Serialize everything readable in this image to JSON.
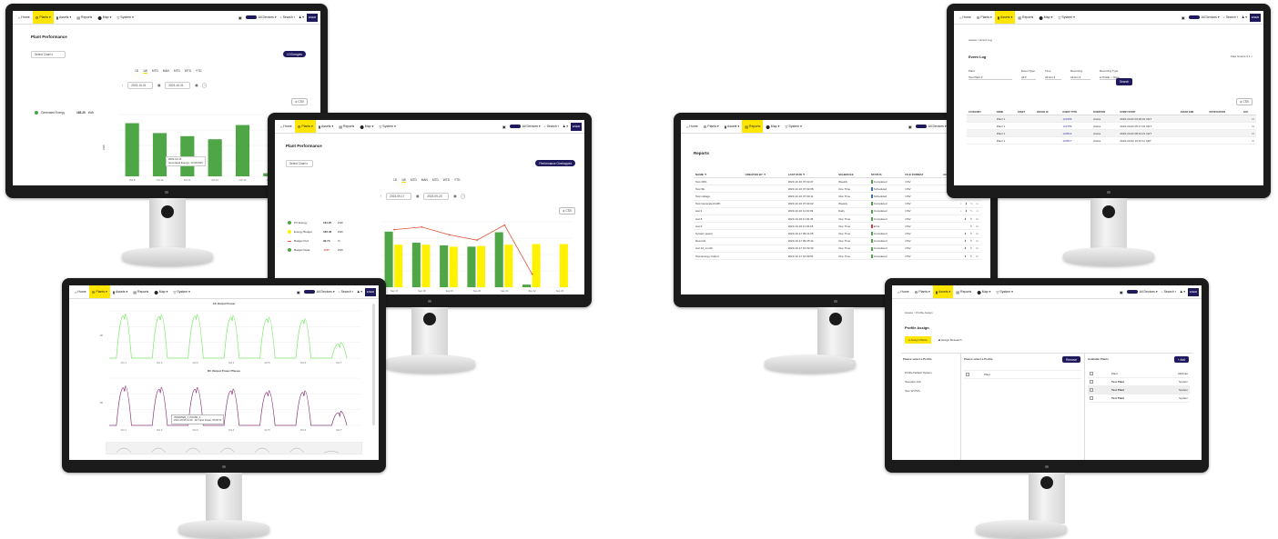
{
  "nav": {
    "items": [
      {
        "icon": "home-icon",
        "glyph": "⌂",
        "label": "Home"
      },
      {
        "icon": "plants-icon",
        "glyph": "⚙",
        "label": "Plants ▾"
      },
      {
        "icon": "assets-icon",
        "glyph": "▮",
        "label": "Assets ▾"
      },
      {
        "icon": "reports-icon",
        "glyph": "▤",
        "label": "Reports"
      },
      {
        "icon": "map-icon",
        "glyph": "⬤",
        "label": "Map ▾"
      },
      {
        "icon": "system-icon",
        "glyph": "▽",
        "label": "System ▾"
      }
    ],
    "right": {
      "bell": "▣",
      "all_devices": "All Devices ▾",
      "search": "⌕ Search ▾",
      "user": "♟ ▾",
      "logo": "ENER"
    }
  },
  "colors": {
    "accent_yellow": "#ffe600",
    "brand_navy": "#1f1a5e",
    "bar_green": "#4ea646",
    "bar_yellow": "#fff200",
    "line_red": "#e0553a",
    "line_green": "#7de86a",
    "line_purple": "#8a3a78"
  },
  "m1": {
    "title": "Plant Performance",
    "select": "Select Chart ▾",
    "badge": "10 Energies",
    "periods": [
      "1D",
      "1W",
      "MTD",
      "MAN",
      "MTD",
      "WTD",
      "YTD"
    ],
    "date_from": "2023-10-01",
    "date_to": "2023-10-31",
    "csv": "⬇ CSV",
    "legend_label": "Generated Energy",
    "legend_value": "165.20",
    "legend_unit": "kWh",
    "ylabel": "kWh",
    "tooltip_1": "2023-10-15",
    "tooltip_2": "Generated Energy: 13.00 kWh",
    "chart_data": {
      "type": "bar",
      "categories": [
        "Oct 9",
        "Oct 10",
        "Oct 11",
        "Oct 12",
        "Oct 13",
        "Oct 14"
      ],
      "values": [
        86,
        70,
        65,
        60,
        83,
        5
      ],
      "ylim": [
        0,
        100
      ]
    }
  },
  "m2": {
    "title": "Plant Performance",
    "select": "Select Chart ▾",
    "badge": "Performance Overlapped",
    "periods": [
      "1D",
      "1W",
      "MTD",
      "MAN",
      "MTD",
      "WTD",
      "YTD"
    ],
    "date_from": "2023-09-17",
    "date_to": "2023-09-23",
    "csv": "⬇ CSV",
    "legend": [
      {
        "color": "#4ea646",
        "label": "PV Energy",
        "value": "181.25",
        "unit": "kWh"
      },
      {
        "color": "#fff200",
        "label": "Energy Budget",
        "value": "182.48",
        "unit": "kWh"
      },
      {
        "color": "#e0553a",
        "label": "Budget Perf.",
        "value": "99.73",
        "unit": "%"
      },
      {
        "color": "#4ea646",
        "label": "Budget Delta",
        "value": "-0.07",
        "unit": "kWh"
      }
    ],
    "chart_data": {
      "type": "bar",
      "categories": [
        "Sep 17",
        "Sep 18",
        "Sep 19",
        "Sep 20",
        "Sep 21",
        "Sep 22",
        "Sep 23"
      ],
      "series": [
        {
          "name": "PV Energy",
          "values": [
            85,
            68,
            64,
            62,
            84,
            4,
            0
          ]
        },
        {
          "name": "Energy Budget",
          "values": [
            65,
            65,
            62,
            63,
            65,
            66,
            66
          ]
        },
        {
          "name": "Budget Perf.",
          "values": [
            88,
            92,
            80,
            72,
            95,
            20,
            0
          ]
        }
      ],
      "ylim": [
        0,
        100
      ]
    }
  },
  "m3": {
    "chart1_title": "AC Output Power",
    "chart2_title": "DC Output Power Phases",
    "tooltip_1": "INVERTER_1_PHASE_A",
    "tooltip_2": "2023-10-05 14:10 · DC Input Power: 86.50 W",
    "ylabel": "W",
    "chart_data": [
      {
        "type": "line",
        "title": "AC Output Power",
        "x": [
          "Oct 1",
          "Oct 2",
          "Oct 3",
          "Oct 4",
          "Oct 5",
          "Oct 6",
          "Oct 7"
        ],
        "y_peaks": [
          1400,
          1380,
          1390,
          1350,
          1300,
          1250,
          500
        ],
        "ylim": [
          0,
          1500
        ]
      },
      {
        "type": "line",
        "title": "DC Output Power Phases",
        "x": [
          "Oct 1",
          "Oct 2",
          "Oct 3",
          "Oct 4",
          "Oct 5",
          "Oct 6",
          "Oct 7"
        ],
        "y_peaks": [
          1250,
          1200,
          1200,
          1150,
          1100,
          1100,
          450
        ],
        "ylim": [
          0,
          1500
        ]
      }
    ]
  },
  "m4": {
    "title": "Reports",
    "create": "+ Create",
    "columns": [
      "NAME ▼",
      "CREATED BY ▼",
      "LAST RUN ▼",
      "SCHEDULE",
      "STATUS",
      "FILE FORMAT",
      "ACTIONS"
    ],
    "rows": [
      {
        "name": "Test 20%",
        "by": "",
        "last": "2023-10-16 07:01:07",
        "sched": "Weekly",
        "status": "Completed",
        "sc": "#4ea646",
        "fmt": "CSV",
        "act": "⌕ ⬇ ✎ ⊡"
      },
      {
        "name": "Test 5E",
        "by": "",
        "last": "2023-10-16 07:02:08",
        "sched": "One Time",
        "status": "Scheduled",
        "sc": "#3a6ad6",
        "fmt": "CSV",
        "act": "✎"
      },
      {
        "name": "Test voltage",
        "by": "",
        "last": "2023-10-16 07:03:11",
        "sched": "One Time",
        "status": "Scheduled",
        "sc": "#3a6ad6",
        "fmt": "CSV",
        "act": "✎"
      },
      {
        "name": "Test Generated kWh",
        "by": "",
        "last": "2023-10-16 07:04:02",
        "sched": "Weekly",
        "status": "Completed",
        "sc": "#4ea646",
        "fmt": "CSV",
        "act": "⌕ ⬇ ✎ ⊡"
      },
      {
        "name": "test 2",
        "by": "",
        "last": "2023-10-16 11:01:09",
        "sched": "Daily",
        "status": "Completed",
        "sc": "#4ea646",
        "fmt": "CSV",
        "act": "⌕ ⬇ ✎ ⊡"
      },
      {
        "name": "test 8",
        "by": "",
        "last": "2023-10-16 11:02:45",
        "sched": "One Time",
        "status": "Completed",
        "sc": "#4ea646",
        "fmt": "CSV",
        "act": "⬇ ✎ ⊡"
      },
      {
        "name": "test 9",
        "by": "",
        "last": "2023-10-16 11:04:18",
        "sched": "One Time",
        "status": "Error",
        "sc": "#d63a3a",
        "fmt": "CSV",
        "act": "✎ ⊡"
      },
      {
        "name": "System power",
        "by": "",
        "last": "2023-10-17 09:21:05",
        "sched": "One Time",
        "status": "Completed",
        "sc": "#4ea646",
        "fmt": "CSV",
        "act": "⬇ ✎ ⊡"
      },
      {
        "name": "Records",
        "by": "",
        "last": "2023-10-17 09:25:44",
        "sched": "One Time",
        "status": "Completed",
        "sc": "#4ea646",
        "fmt": "CSV",
        "act": "⬇ ✎ ⊡"
      },
      {
        "name": "test 12_month",
        "by": "",
        "last": "2023-10-17 10:02:30",
        "sched": "One Time",
        "status": "Completed",
        "sc": "#4ea646",
        "fmt": "CSV",
        "act": "⬇ ✎ ⊡"
      },
      {
        "name": "Test Energy Output",
        "by": "",
        "last": "2023-10-17 10:09:51",
        "sched": "One Time",
        "status": "Completed",
        "sc": "#4ea646",
        "fmt": "CSV",
        "act": "⬇ ✎ ⊡"
      }
    ]
  },
  "m5": {
    "breadcrumb": "Assets  >  Event Log",
    "title": "Event Log",
    "filter_badge": "Filter Events ▾  1  ×",
    "labels": [
      "Plant",
      "Event Type",
      "Time",
      "Recurring",
      "Recurring Type"
    ],
    "values": [
      "Test Plant ▾",
      "All ▾",
      "All Hrs ▾",
      "All Hrs ▾",
      "● Profile  ○ None"
    ],
    "search": "Search",
    "csv": "⬇ CSV",
    "columns": [
      "CATEGORY",
      "NAME",
      "ASSET",
      "DEVICE ID",
      "EVENT TYPE",
      "DURATION",
      "EVENT START",
      "EVENT END",
      "NOTIFICATION",
      "ACK"
    ],
    "rows": [
      {
        "cat": "",
        "name": "Plant 1",
        "type": "123456",
        "dur": "Active",
        "start": "2023-10-02 03:20:01 CET"
      },
      {
        "cat": "",
        "name": "Plant 1",
        "type": "123789",
        "dur": "Active",
        "start": "2023-10-02 05:17:01 CET"
      },
      {
        "cat": "",
        "name": "Plant 1",
        "type": "123812",
        "dur": "Active",
        "start": "2023-10-02 08:44:21 CET"
      },
      {
        "cat": "",
        "name": "Plant 1",
        "type": "123817",
        "dur": "Active",
        "start": "2023-10-02 10:31:11 CET"
      }
    ]
  },
  "m6": {
    "breadcrumb": "Assets  >  Profile Assign",
    "title": "Profile Assign",
    "tab1": "Assign Plants",
    "tab2": "Assign Research",
    "col1_title": "Please select a Profile",
    "col1_items": [
      "Profile Default System",
      "Scenario 123",
      "Test 12 PVS"
    ],
    "col2_title": "Please select a Profile",
    "col2_btn": "Remove",
    "col2_items": [
      "Plant"
    ],
    "col3_title": "Available Plants",
    "col3_btn": "+ Add",
    "col3_header": [
      "Plant",
      "Attribute"
    ],
    "col3_rows": [
      {
        "name": "Plant",
        "attr": "Attribute"
      },
      {
        "name": "Test Plant",
        "attr": "System"
      },
      {
        "name": "Test Plant",
        "attr": "System"
      },
      {
        "name": "Test Plant",
        "attr": "System"
      }
    ]
  }
}
